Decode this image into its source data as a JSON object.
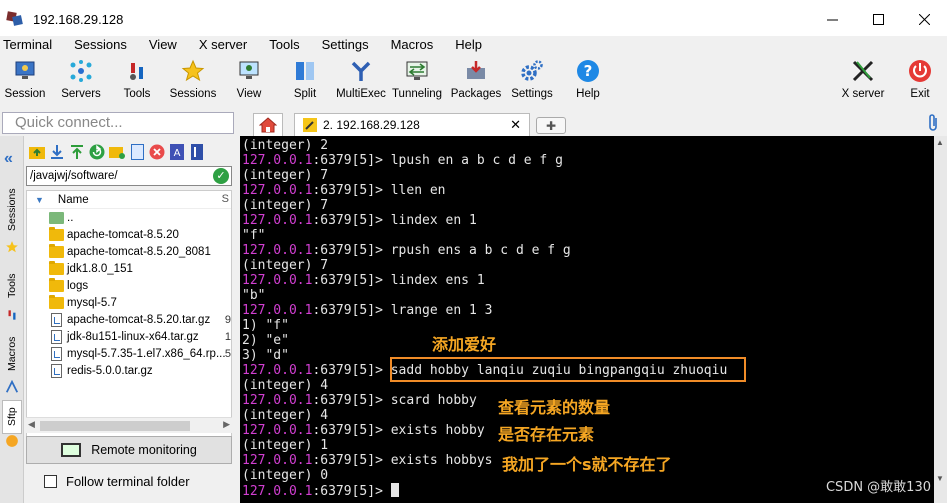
{
  "window": {
    "title": "192.168.29.128"
  },
  "menu": [
    "Terminal",
    "Sessions",
    "View",
    "X server",
    "Tools",
    "Settings",
    "Macros",
    "Help"
  ],
  "toolbar": [
    {
      "label": "Session"
    },
    {
      "label": "Servers"
    },
    {
      "label": "Tools"
    },
    {
      "label": "Sessions"
    },
    {
      "label": "View"
    },
    {
      "label": "Split"
    },
    {
      "label": "MultiExec"
    },
    {
      "label": "Tunneling"
    },
    {
      "label": "Packages"
    },
    {
      "label": "Settings"
    },
    {
      "label": "Help"
    }
  ],
  "toolbar_right": [
    {
      "label": "X server"
    },
    {
      "label": "Exit"
    }
  ],
  "quick_connect": {
    "placeholder": "Quick connect..."
  },
  "tabs": {
    "session_tab": "2. 192.168.29.128"
  },
  "side_tabs": [
    "Sessions",
    "Tools",
    "Macros",
    "Sftp"
  ],
  "sftp": {
    "path": "/javajwj/software/",
    "column_name": "Name",
    "column_size": "S",
    "items": [
      {
        "name": "..",
        "type": "up"
      },
      {
        "name": "apache-tomcat-8.5.20",
        "type": "folder"
      },
      {
        "name": "apache-tomcat-8.5.20_8081",
        "type": "folder"
      },
      {
        "name": "jdk1.8.0_151",
        "type": "folder"
      },
      {
        "name": "logs",
        "type": "folder"
      },
      {
        "name": "mysql-5.7",
        "type": "folder"
      },
      {
        "name": "apache-tomcat-8.5.20.tar.gz",
        "type": "file",
        "trail": "9"
      },
      {
        "name": "jdk-8u151-linux-x64.tar.gz",
        "type": "file",
        "trail": "1"
      },
      {
        "name": "mysql-5.7.35-1.el7.x86_64.rp...",
        "type": "file",
        "trail": "5"
      },
      {
        "name": "redis-5.0.0.tar.gz",
        "type": "file",
        "trail": ""
      }
    ],
    "remote_monitoring": "Remote monitoring",
    "follow_terminal": "Follow terminal folder"
  },
  "terminal": {
    "lines": [
      {
        "out": "(integer) 2"
      },
      {
        "host": "127.0.0.1",
        "rest": ":6379[5]> lpush en a b c d e f g"
      },
      {
        "out": "(integer) 7"
      },
      {
        "host": "127.0.0.1",
        "rest": ":6379[5]> llen en"
      },
      {
        "out": "(integer) 7"
      },
      {
        "host": "127.0.0.1",
        "rest": ":6379[5]> lindex en 1"
      },
      {
        "out": "\"f\""
      },
      {
        "host": "127.0.0.1",
        "rest": ":6379[5]> rpush ens a b c d e f g"
      },
      {
        "out": "(integer) 7"
      },
      {
        "host": "127.0.0.1",
        "rest": ":6379[5]> lindex ens 1"
      },
      {
        "out": "\"b\""
      },
      {
        "host": "127.0.0.1",
        "rest": ":6379[5]> lrange en 1 3"
      },
      {
        "out": "1) \"f\""
      },
      {
        "out": "2) \"e\""
      },
      {
        "out": "3) \"d\""
      },
      {
        "host": "127.0.0.1",
        "rest": ":6379[5]> sadd hobby lanqiu zuqiu bingpangqiu zhuoqiu"
      },
      {
        "out": "(integer) 4"
      },
      {
        "host": "127.0.0.1",
        "rest": ":6379[5]> scard hobby"
      },
      {
        "out": "(integer) 4"
      },
      {
        "host": "127.0.0.1",
        "rest": ":6379[5]> exists hobby"
      },
      {
        "out": "(integer) 1"
      },
      {
        "host": "127.0.0.1",
        "rest": ":6379[5]> exists hobbys"
      },
      {
        "out": "(integer) 0"
      },
      {
        "host": "127.0.0.1",
        "rest": ":6379[5]> ",
        "cursor": true
      }
    ],
    "annotations": {
      "add_hobby": "添加爱好",
      "count": "查看元素的数量",
      "exists": "是否存在元素",
      "exists_s": "我加了一个s就不存在了"
    },
    "highlight_color": "#f08c28",
    "prompt_color": "#d23fd2"
  },
  "watermark": "CSDN @敢敢130"
}
